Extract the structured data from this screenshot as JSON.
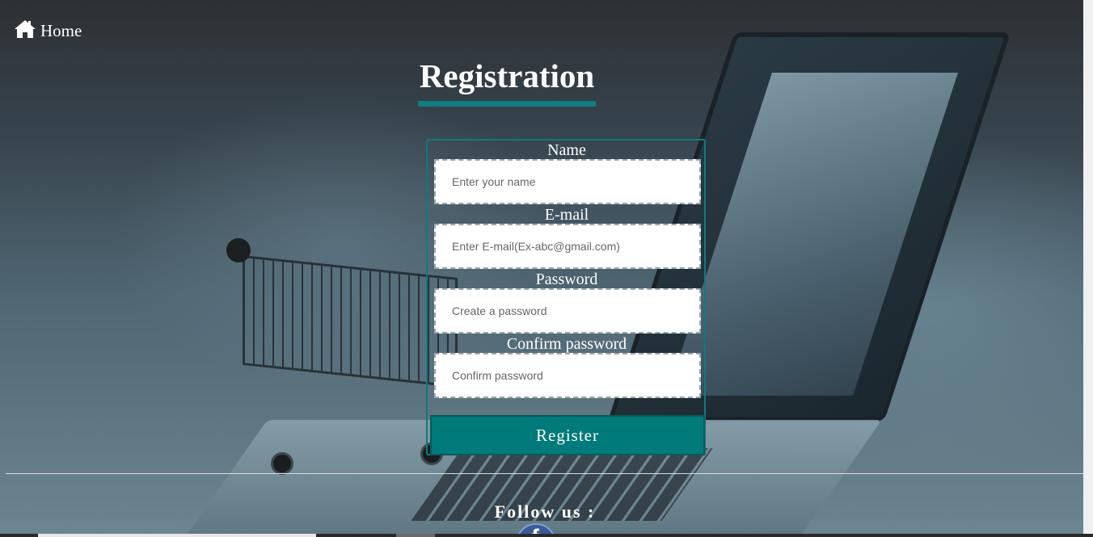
{
  "nav": {
    "home_label": "Home",
    "home_icon": "home-icon"
  },
  "page": {
    "title": "Registration"
  },
  "form": {
    "name": {
      "label": "Name",
      "placeholder": "Enter your name",
      "value": ""
    },
    "email": {
      "label": "E-mail",
      "placeholder": "Enter E-mail(Ex-abc@gmail.com)",
      "value": ""
    },
    "password": {
      "label": "Password",
      "placeholder": "Create a password",
      "value": ""
    },
    "confirm_password": {
      "label": "Confirm password",
      "placeholder": "Confirm password",
      "value": ""
    },
    "submit_label": "Register"
  },
  "footer": {
    "follow_label": "Follow us :",
    "social_icon": "facebook-icon"
  },
  "colors": {
    "accent": "#007a7a",
    "text": "#ffffff",
    "background": "#3c4a52"
  }
}
